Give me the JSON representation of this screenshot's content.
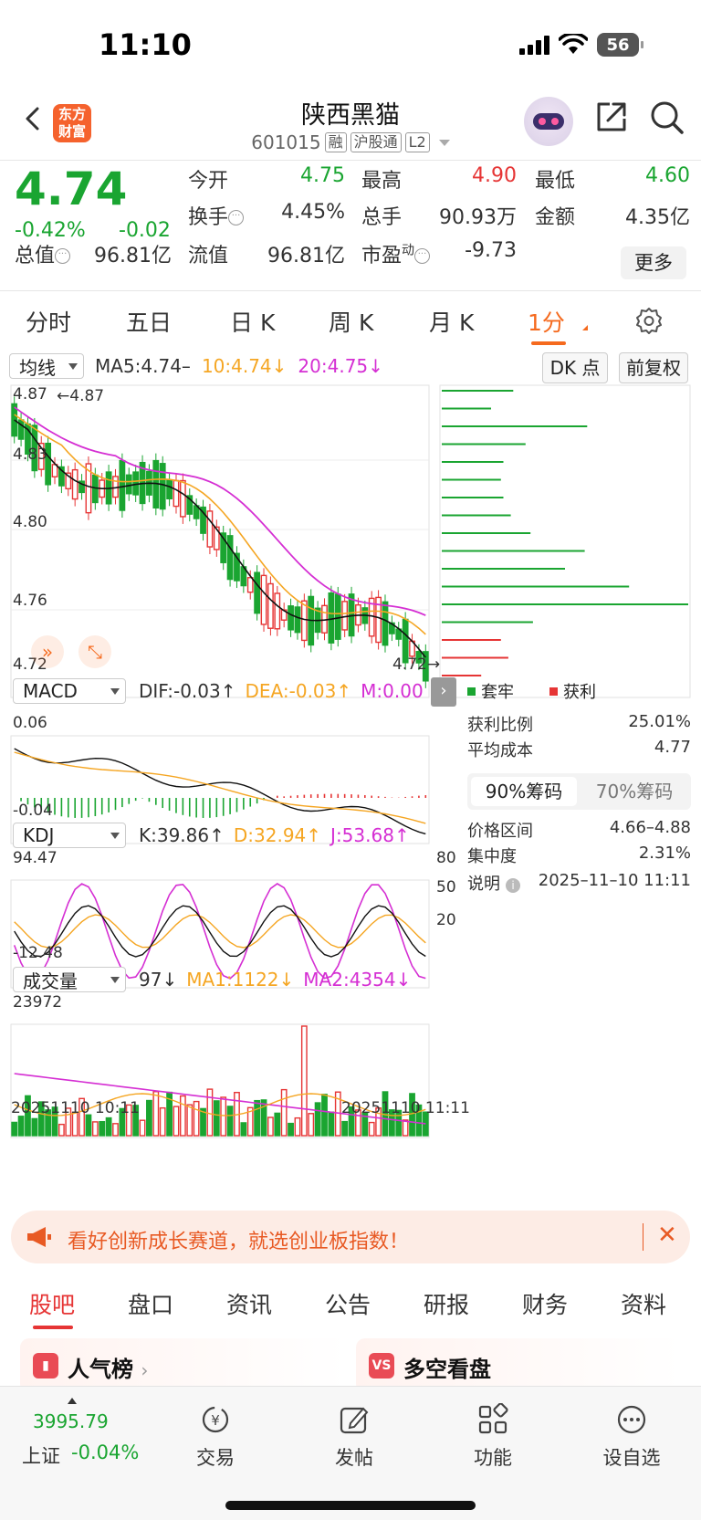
{
  "status": {
    "time": "11:10",
    "battery": "56"
  },
  "header": {
    "logo_text": "东方财富",
    "stock_name": "陕西黑猫",
    "stock_code": "601015",
    "tags": [
      "融",
      "沪股通",
      "L2"
    ]
  },
  "quote": {
    "price": "4.74",
    "change_pct": "-0.42%",
    "change_abs": "-0.02",
    "open_label": "今开",
    "open_value": "4.75",
    "high_label": "最高",
    "high_value": "4.90",
    "low_label": "最低",
    "low_value": "4.60",
    "turnover_label": "换手",
    "turnover_value": "4.45%",
    "volume_label": "总手",
    "volume_value": "90.93万",
    "amount_label": "金额",
    "amount_value": "4.35亿",
    "mktcap_label": "总值",
    "mktcap_value": "96.81亿",
    "float_label": "流值",
    "float_value": "96.81亿",
    "pe_label": "市盈",
    "pe_sup": "动",
    "pe_value": "-9.73",
    "more_button": "更多"
  },
  "chart_tabs": {
    "items": [
      "分时",
      "五日",
      "日 K",
      "周 K",
      "月 K",
      "1分"
    ],
    "active_index": 5
  },
  "main_chart": {
    "indicator_select": "均线",
    "ma5_label": "MA5:4.74–",
    "ma10_label": "10:4.74",
    "ma20_label": "20:4.75",
    "dk_button": "DK 点",
    "fq_button": "前复权",
    "y_ticks": [
      "4.87",
      "4.83",
      "4.80",
      "4.76",
      "4.72"
    ],
    "high_marker": "4.87",
    "low_marker": "4.72",
    "colors": {
      "up": "#e63535",
      "down": "#1aa531",
      "ma5": "#111111",
      "ma10": "#f5a623",
      "ma20": "#d52fd3"
    }
  },
  "macd": {
    "select": "MACD",
    "dif_label": "DIF:-0.03",
    "dea_label": "DEA:-0.03",
    "m_label": "M:0.00",
    "y_top": "0.06",
    "y_bottom": "-0.04"
  },
  "kdj": {
    "select": "KDJ",
    "k_label": "K:39.86",
    "d_label": "D:32.94",
    "j_label": "J:53.68",
    "y_top": "94.47",
    "y_bottom": "-12.48",
    "levels": [
      "80",
      "50",
      "20"
    ]
  },
  "volume": {
    "select": "成交量",
    "vol_label": "97",
    "ma1_label": "MA1:1122",
    "ma2_label": "MA2:4354",
    "y_top": "23972",
    "start_time": "20251110 10:11",
    "end_time": "20251110 11:11"
  },
  "chips": {
    "legend_trapped": "套牢",
    "legend_profit": "获利",
    "profit_ratio_label": "获利比例",
    "profit_ratio_value": "25.01%",
    "avg_cost_label": "平均成本",
    "avg_cost_value": "4.77",
    "toggle_90": "90%筹码",
    "toggle_70": "70%筹码",
    "price_range_label": "价格区间",
    "price_range_value": "4.66–4.88",
    "concentration_label": "集中度",
    "concentration_value": "2.31%",
    "note_label": "说明",
    "note_value": "2025–11–10 11:11",
    "bars": [
      {
        "color": "#1aa531",
        "len": 0.29
      },
      {
        "color": "#1aa531",
        "len": 0.2
      },
      {
        "color": "#1aa531",
        "len": 0.59
      },
      {
        "color": "#1aa531",
        "len": 0.34
      },
      {
        "color": "#1aa531",
        "len": 0.25
      },
      {
        "color": "#1aa531",
        "len": 0.24
      },
      {
        "color": "#1aa531",
        "len": 0.25
      },
      {
        "color": "#1aa531",
        "len": 0.28
      },
      {
        "color": "#1aa531",
        "len": 0.36
      },
      {
        "color": "#1aa531",
        "len": 0.58
      },
      {
        "color": "#1aa531",
        "len": 0.5
      },
      {
        "color": "#1aa531",
        "len": 0.76
      },
      {
        "color": "#1aa531",
        "len": 1.0
      },
      {
        "color": "#1aa531",
        "len": 0.37
      },
      {
        "color": "#e63535",
        "len": 0.24
      },
      {
        "color": "#e63535",
        "len": 0.27
      },
      {
        "color": "#e63535",
        "len": 0.16
      }
    ]
  },
  "banner": {
    "text": "看好创新成长赛道，就选创业板指数！"
  },
  "bottom_tabs": {
    "items": [
      "股吧",
      "盘口",
      "资讯",
      "公告",
      "研报",
      "财务",
      "资料"
    ],
    "active_index": 0
  },
  "cards": {
    "left_title": "人气榜",
    "right_title": "多空看盘",
    "right_icon": "VS"
  },
  "bottom_nav": {
    "index_value": "3995.79",
    "index_label": "上证",
    "index_pct": "-0.04%",
    "items": [
      "交易",
      "发帖",
      "功能",
      "设自选"
    ]
  }
}
